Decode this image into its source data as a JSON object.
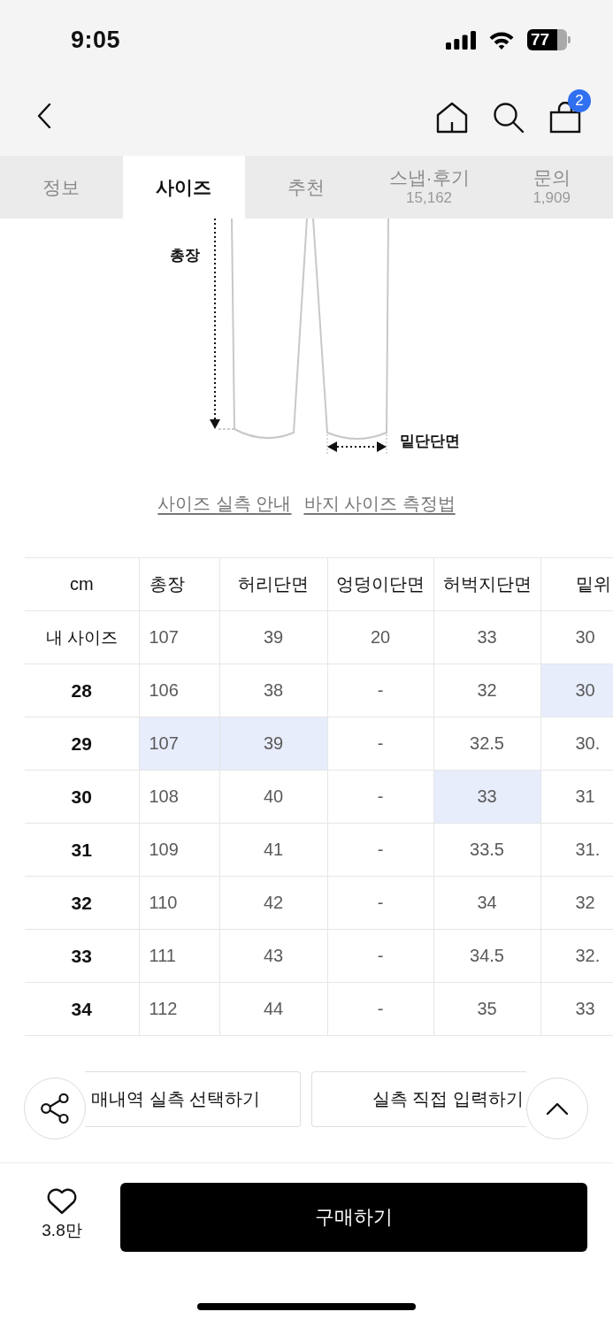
{
  "status_bar": {
    "time": "9:05",
    "battery": "77"
  },
  "nav_bar": {
    "cart_badge": "2"
  },
  "tabs": [
    {
      "label": "정보",
      "selected": false
    },
    {
      "label": "사이즈",
      "selected": true
    },
    {
      "label": "추천",
      "selected": false
    },
    {
      "label": "스냅·후기",
      "count": "15,162",
      "selected": false
    },
    {
      "label": "문의",
      "count": "1,909",
      "selected": false
    }
  ],
  "diagram": {
    "length_label": "총장",
    "hem_label": "밑단단면"
  },
  "links": [
    "사이즈 실측 안내",
    "바지 사이즈 측정법"
  ],
  "size_table": {
    "corner": "cm",
    "columns": [
      "총장",
      "허리단면",
      "엉덩이단면",
      "허벅지단면",
      "밑위"
    ],
    "rows": [
      {
        "label": "내 사이즈",
        "kind": "my_size",
        "cells": [
          {
            "text": "107",
            "highlighted": false
          },
          {
            "text": "39",
            "highlighted": false
          },
          {
            "text": "20",
            "highlighted": false
          },
          {
            "text": "33",
            "highlighted": false
          },
          {
            "text": "30",
            "highlighted": false
          }
        ]
      },
      {
        "label": "28",
        "kind": "size",
        "cells": [
          {
            "text": "106",
            "highlighted": false
          },
          {
            "text": "38",
            "highlighted": false
          },
          {
            "text": "-",
            "highlighted": false
          },
          {
            "text": "32",
            "highlighted": false
          },
          {
            "text": "30",
            "highlighted": true
          }
        ]
      },
      {
        "label": "29",
        "kind": "size",
        "cells": [
          {
            "text": "107",
            "highlighted": true
          },
          {
            "text": "39",
            "highlighted": true
          },
          {
            "text": "-",
            "highlighted": false
          },
          {
            "text": "32.5",
            "highlighted": false
          },
          {
            "text": "30.",
            "highlighted": false
          }
        ]
      },
      {
        "label": "30",
        "kind": "size",
        "cells": [
          {
            "text": "108",
            "highlighted": false
          },
          {
            "text": "40",
            "highlighted": false
          },
          {
            "text": "-",
            "highlighted": false
          },
          {
            "text": "33",
            "highlighted": true
          },
          {
            "text": "31",
            "highlighted": false
          }
        ]
      },
      {
        "label": "31",
        "kind": "size",
        "cells": [
          {
            "text": "109",
            "highlighted": false
          },
          {
            "text": "41",
            "highlighted": false
          },
          {
            "text": "-",
            "highlighted": false
          },
          {
            "text": "33.5",
            "highlighted": false
          },
          {
            "text": "31.",
            "highlighted": false
          }
        ]
      },
      {
        "label": "32",
        "kind": "size",
        "cells": [
          {
            "text": "110",
            "highlighted": false
          },
          {
            "text": "42",
            "highlighted": false
          },
          {
            "text": "-",
            "highlighted": false
          },
          {
            "text": "34",
            "highlighted": false
          },
          {
            "text": "32",
            "highlighted": false
          }
        ]
      },
      {
        "label": "33",
        "kind": "size",
        "cells": [
          {
            "text": "111",
            "highlighted": false
          },
          {
            "text": "43",
            "highlighted": false
          },
          {
            "text": "-",
            "highlighted": false
          },
          {
            "text": "34.5",
            "highlighted": false
          },
          {
            "text": "32.",
            "highlighted": false
          }
        ]
      },
      {
        "label": "34",
        "kind": "size",
        "cells": [
          {
            "text": "112",
            "highlighted": false
          },
          {
            "text": "44",
            "highlighted": false
          },
          {
            "text": "-",
            "highlighted": false
          },
          {
            "text": "35",
            "highlighted": false
          },
          {
            "text": "33",
            "highlighted": false
          }
        ]
      }
    ]
  },
  "buttons": [
    "매내역 실측 선택하기",
    "실측 직접 입력하기"
  ],
  "bottom_bar": {
    "likes": "3.8만",
    "buy": "구매하기"
  }
}
